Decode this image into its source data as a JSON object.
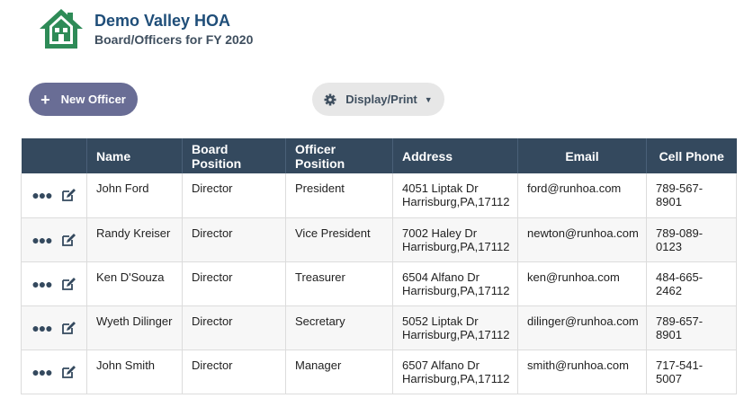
{
  "header": {
    "org_name": "Demo Valley HOA",
    "subtitle": "Board/Officers for FY 2020",
    "logo_icon": "house-icon",
    "logo_color": "#2e8b57"
  },
  "toolbar": {
    "new_officer_label": "New Officer",
    "display_print_label": "Display/Print"
  },
  "table": {
    "columns": [
      "",
      "Name",
      "Board Position",
      "Officer Position",
      "Address",
      "Email",
      "Cell Phone"
    ],
    "rows": [
      {
        "name": "John Ford",
        "board": "Director",
        "officer": "President",
        "addr1": "4051 Liptak Dr",
        "addr2": "Harrisburg,PA,17112",
        "email": "ford@runhoa.com",
        "phone": "789-567-8901"
      },
      {
        "name": "Randy Kreiser",
        "board": "Director",
        "officer": "Vice President",
        "addr1": "7002 Haley Dr",
        "addr2": "Harrisburg,PA,17112",
        "email": "newton@runhoa.com",
        "phone": "789-089-0123"
      },
      {
        "name": "Ken D'Souza",
        "board": "Director",
        "officer": "Treasurer",
        "addr1": "6504 Alfano Dr",
        "addr2": "Harrisburg,PA,17112",
        "email": "ken@runhoa.com",
        "phone": "484-665-2462"
      },
      {
        "name": "Wyeth Dilinger",
        "board": "Director",
        "officer": "Secretary",
        "addr1": "5052 Liptak Dr",
        "addr2": "Harrisburg,PA,17112",
        "email": "dilinger@runhoa.com",
        "phone": "789-657-8901"
      },
      {
        "name": "John Smith",
        "board": "Director",
        "officer": "Manager",
        "addr1": "6507 Alfano Dr",
        "addr2": "Harrisburg,PA,17112",
        "email": "smith@runhoa.com",
        "phone": "717-541-5007"
      }
    ]
  },
  "colors": {
    "header_bg": "#34495e",
    "new_button_bg": "#696d95",
    "display_button_bg": "#e7e7e7",
    "title_color": "#1f4e79"
  }
}
